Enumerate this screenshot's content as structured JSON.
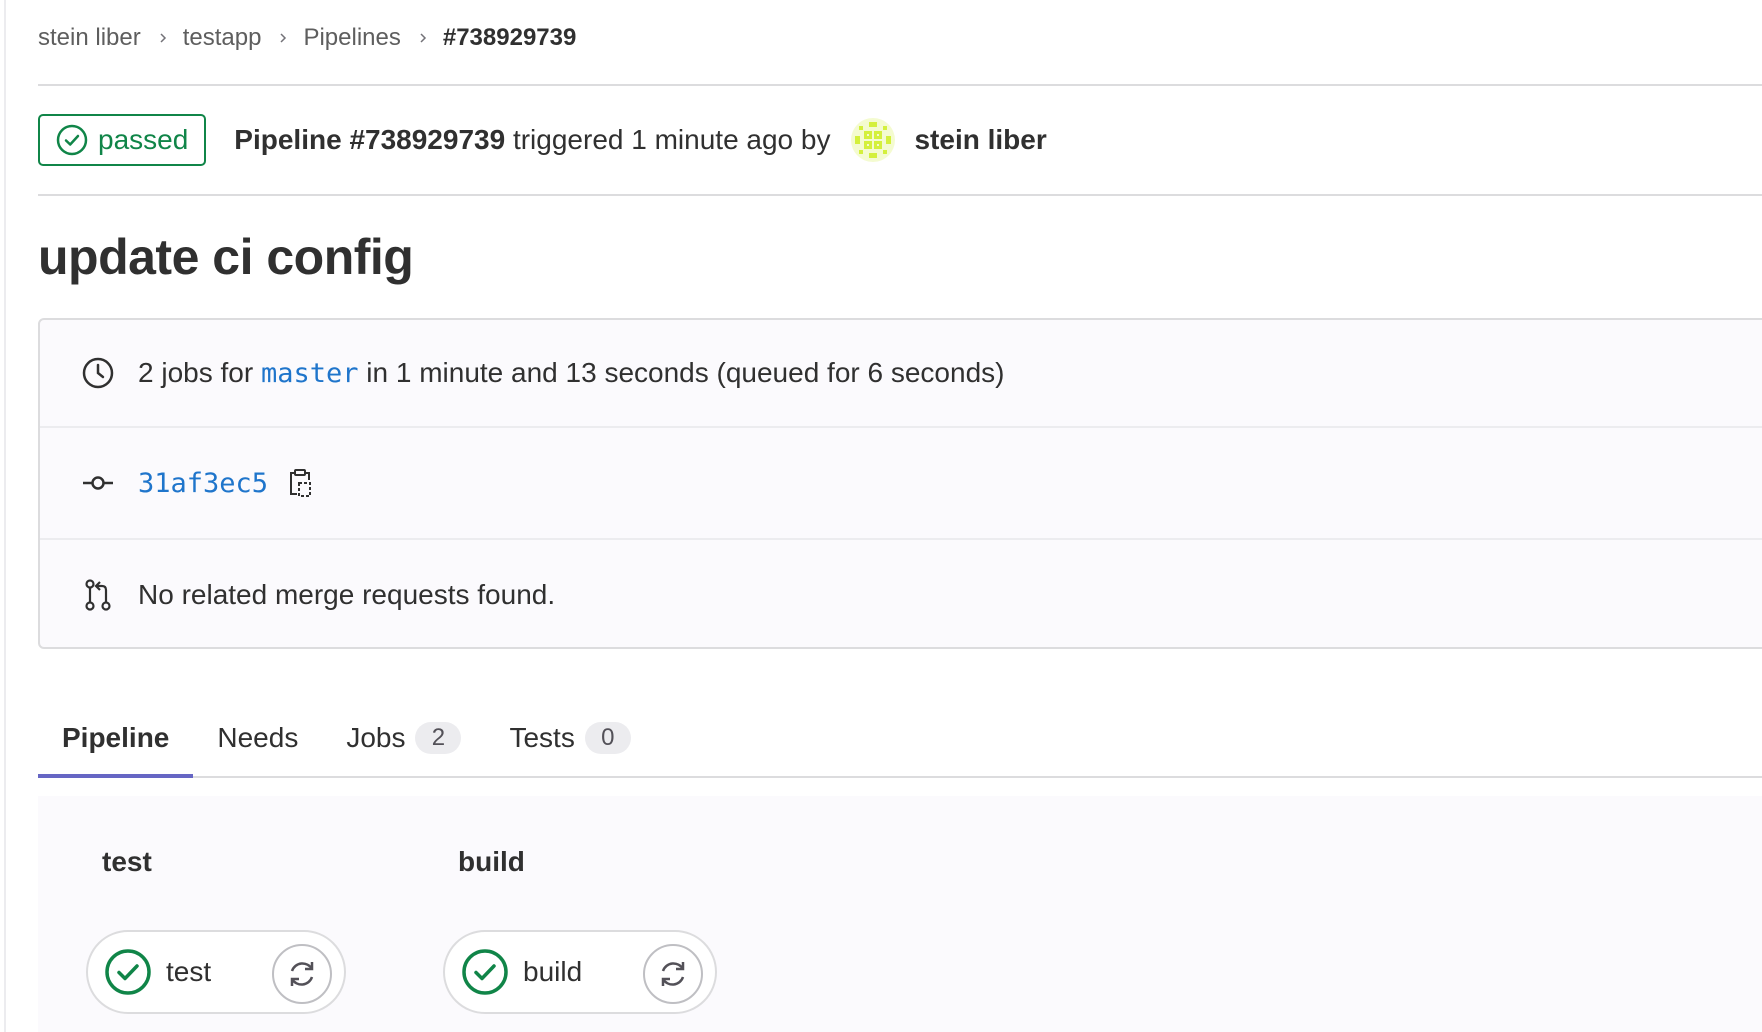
{
  "breadcrumb": {
    "items": [
      "stein liber",
      "testapp",
      "Pipelines"
    ],
    "current": "#738929739"
  },
  "header": {
    "status": "passed",
    "pipeline_label": "Pipeline #738929739",
    "triggered_text": "triggered 1 minute ago by",
    "author": "stein liber"
  },
  "commit": {
    "title": "update ci config"
  },
  "info": {
    "jobs_prefix": "2 jobs for",
    "branch": "master",
    "duration_text": "in 1 minute and 13 seconds (queued for 6 seconds)",
    "sha": "31af3ec5",
    "merge_requests_text": "No related merge requests found."
  },
  "tabs": [
    {
      "label": "Pipeline",
      "active": true
    },
    {
      "label": "Needs"
    },
    {
      "label": "Jobs",
      "count": "2"
    },
    {
      "label": "Tests",
      "count": "0"
    }
  ],
  "stages": [
    {
      "title": "test",
      "job": "test",
      "status": "passed"
    },
    {
      "title": "build",
      "job": "build",
      "status": "passed"
    }
  ],
  "colors": {
    "success": "#108548",
    "link": "#1f75cb",
    "tab_indicator": "#6666c4",
    "avatar": "#d4f03c"
  },
  "icons": {
    "status": "status-success-icon",
    "clock": "clock-icon",
    "commit": "commit-icon",
    "copy": "copy-to-clipboard-icon",
    "merge_request": "merge-request-icon",
    "retry": "retry-icon",
    "breadcrumb_separator": "chevron-right-icon"
  }
}
